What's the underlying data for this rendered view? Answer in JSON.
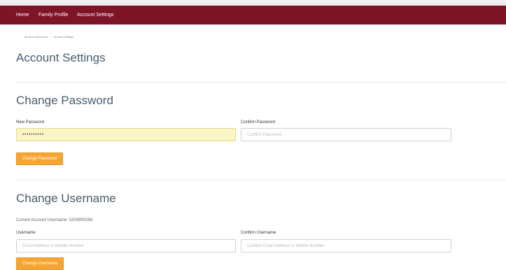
{
  "nav": {
    "home": "Home",
    "family_profile": "Family Profile",
    "account_settings": "Account Settings"
  },
  "breadcrumb": {
    "parent": "student dashboard",
    "separator": ">",
    "current": "account settings"
  },
  "page_title": "Account Settings",
  "change_password": {
    "heading": "Change Password",
    "new_password_label": "New Password",
    "new_password_value": "••••••••••",
    "confirm_password_label": "Confirm Password",
    "confirm_password_placeholder": "Confirm Password",
    "button_label": "Change Password"
  },
  "change_username": {
    "heading": "Change Username",
    "current_username_text": "Current Account Username: 5204990269",
    "username_label": "Username",
    "username_placeholder": "Email Address or Mobile Number",
    "confirm_username_label": "Confirm Username",
    "confirm_username_placeholder": "Confirm Email Address or Mobile Number",
    "button_label": "Change Username"
  },
  "colors": {
    "nav_background": "#7e1428",
    "heading_text": "#475d6f",
    "button_background": "#f7a532",
    "autofill_background": "#fbf4c4"
  }
}
